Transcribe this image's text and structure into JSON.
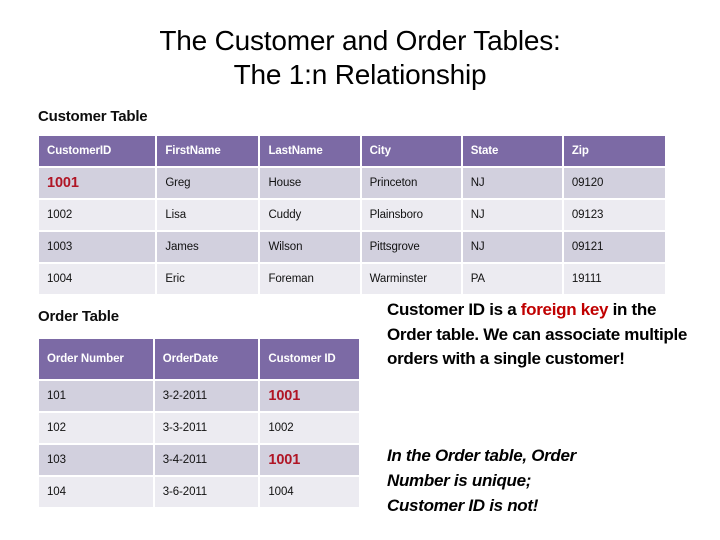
{
  "slide": {
    "title_line1": "The Customer and Order Tables:",
    "title_line2": "The 1:n Relationship"
  },
  "customer_section": {
    "caption": "Customer Table",
    "columns": [
      "CustomerID",
      "FirstName",
      "LastName",
      "City",
      "State",
      "Zip"
    ],
    "rows": [
      {
        "CustomerID": "1001",
        "FirstName": "Greg",
        "LastName": "House",
        "City": "Princeton",
        "State": "NJ",
        "Zip": "09120",
        "highlight_id": true
      },
      {
        "CustomerID": "1002",
        "FirstName": "Lisa",
        "LastName": "Cuddy",
        "City": "Plainsboro",
        "State": "NJ",
        "Zip": "09123",
        "highlight_id": false
      },
      {
        "CustomerID": "1003",
        "FirstName": "James",
        "LastName": "Wilson",
        "City": "Pittsgrove",
        "State": "NJ",
        "Zip": "09121",
        "highlight_id": false
      },
      {
        "CustomerID": "1004",
        "FirstName": "Eric",
        "LastName": "Foreman",
        "City": "Warminster",
        "State": "PA",
        "Zip": "19111",
        "highlight_id": false
      }
    ]
  },
  "order_section": {
    "caption": "Order Table",
    "columns": [
      "Order Number",
      "OrderDate",
      "Customer ID"
    ],
    "rows": [
      {
        "OrderNumber": "101",
        "OrderDate": "3-2-2011",
        "CustomerID": "1001",
        "highlight_cid": true
      },
      {
        "OrderNumber": "102",
        "OrderDate": "3-3-2011",
        "CustomerID": "1002",
        "highlight_cid": false
      },
      {
        "OrderNumber": "103",
        "OrderDate": "3-4-2011",
        "CustomerID": "1001",
        "highlight_cid": true
      },
      {
        "OrderNumber": "104",
        "OrderDate": "3-6-2011",
        "CustomerID": "1004",
        "highlight_cid": false
      }
    ]
  },
  "notes": {
    "foreign_key": {
      "part1": "Customer ID is a ",
      "keyword": "foreign key",
      "part2": " in the Order table. We can associate multiple orders with a single customer!"
    },
    "unique": {
      "line1": "In the Order table, Order",
      "line2": "Number is unique;",
      "line3": "Customer ID is not!"
    }
  },
  "colors": {
    "header_purple": "#7c6aa5",
    "row_dark": "#d2d0de",
    "row_light": "#ecebf1",
    "highlight_red": "#b01525",
    "keyword_red": "#c00000"
  }
}
